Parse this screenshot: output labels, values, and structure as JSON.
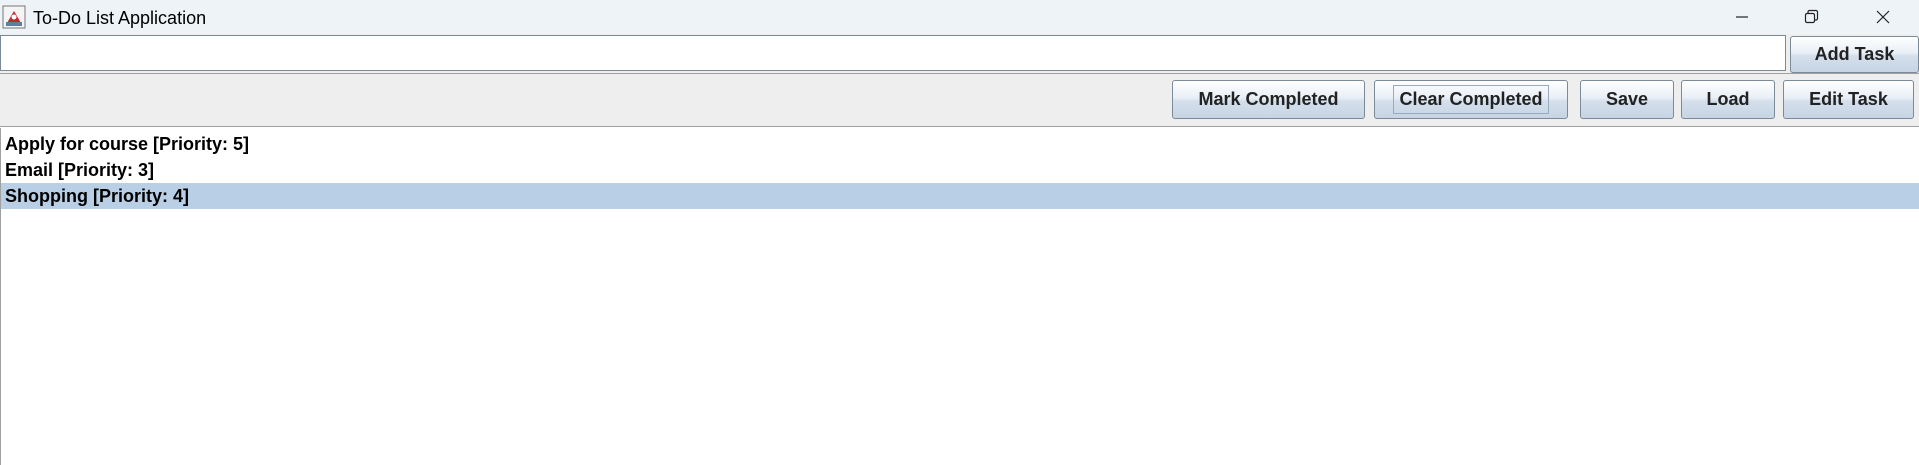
{
  "window": {
    "title": "To-Do List Application"
  },
  "input": {
    "value": "",
    "add_button_label": "Add Task"
  },
  "toolbar": {
    "mark_completed_label": "Mark Completed",
    "clear_completed_label": "Clear Completed",
    "save_label": "Save",
    "load_label": "Load",
    "edit_task_label": "Edit Task"
  },
  "tasks": [
    {
      "label": "Apply for course [Priority: 5]",
      "selected": false
    },
    {
      "label": "Email [Priority: 3]",
      "selected": false
    },
    {
      "label": "Shopping [Priority: 4]",
      "selected": true
    }
  ],
  "colors": {
    "selection": "#b8cfe5",
    "titlebar": "#eef3f8",
    "panel": "#eeeeee"
  }
}
